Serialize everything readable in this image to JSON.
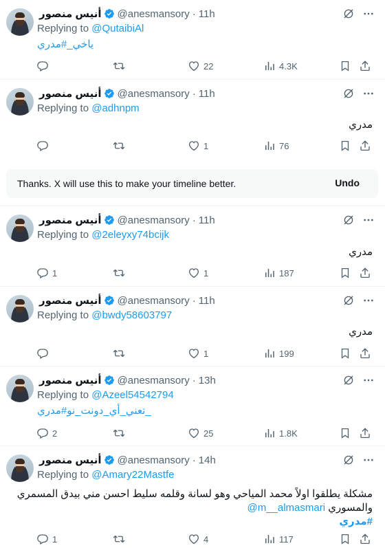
{
  "tweets": [
    {
      "name": "أنيس منصور",
      "handle": "@anesmansory",
      "time": "11h",
      "replying_prefix": "Replying to ",
      "reply_to": "@QutaibiAl",
      "body": "ياخي_#مدري",
      "replies": "",
      "likes": "22",
      "views": "4.3K"
    },
    {
      "name": "أنيس منصور",
      "handle": "@anesmansory",
      "time": "11h",
      "replying_prefix": "Replying to ",
      "reply_to": "@adhnpm",
      "body": "مدري",
      "replies": "",
      "likes": "1",
      "views": "76"
    },
    {
      "name": "أنيس منصور",
      "handle": "@anesmansory",
      "time": "11h",
      "replying_prefix": "Replying to ",
      "reply_to": "@2eleyxy74bcijk",
      "body": "مدري",
      "replies": "1",
      "likes": "1",
      "views": "187"
    },
    {
      "name": "أنيس منصور",
      "handle": "@anesmansory",
      "time": "11h",
      "replying_prefix": "Replying to ",
      "reply_to": "@bwdy58603797",
      "body": "مدري",
      "replies": "",
      "likes": "1",
      "views": "199"
    },
    {
      "name": "أنيس منصور",
      "handle": "@anesmansory",
      "time": "13h",
      "replying_prefix": "Replying to ",
      "reply_to": "@Azeel54542794",
      "body": "_تعني_أي_دونت_نو#مدري",
      "replies": "2",
      "likes": "25",
      "views": "1.8K"
    },
    {
      "name": "أنيس منصور",
      "handle": "@anesmansory",
      "time": "14h",
      "replying_prefix": "Replying to ",
      "reply_to": "@Amary22Mastfe",
      "body_line1": "مشكلة يطلقوا اولاً محمد المياحي وهو لسانة وقلمه سليط احسن مني بيدق المسمري",
      "body_line2_text": "والمسوري ",
      "body_line2_mention": "@m__almasmari",
      "body_line3": "#مدري",
      "replies": "1",
      "likes": "4",
      "views": "117"
    }
  ],
  "feedback": {
    "message": "Thanks. X will use this to make your timeline better.",
    "undo": "Undo"
  },
  "icons": {
    "verified": "verified-badge-icon",
    "hide": "hide-reply-icon",
    "more": "more-icon",
    "reply": "reply-icon",
    "retweet": "retweet-icon",
    "like": "like-icon",
    "views": "views-icon",
    "bookmark": "bookmark-icon",
    "share": "share-icon"
  },
  "colors": {
    "link": "#1d9bf0",
    "muted": "#536471",
    "text": "#0f1419",
    "feedback_bg": "#f7f9f9"
  }
}
